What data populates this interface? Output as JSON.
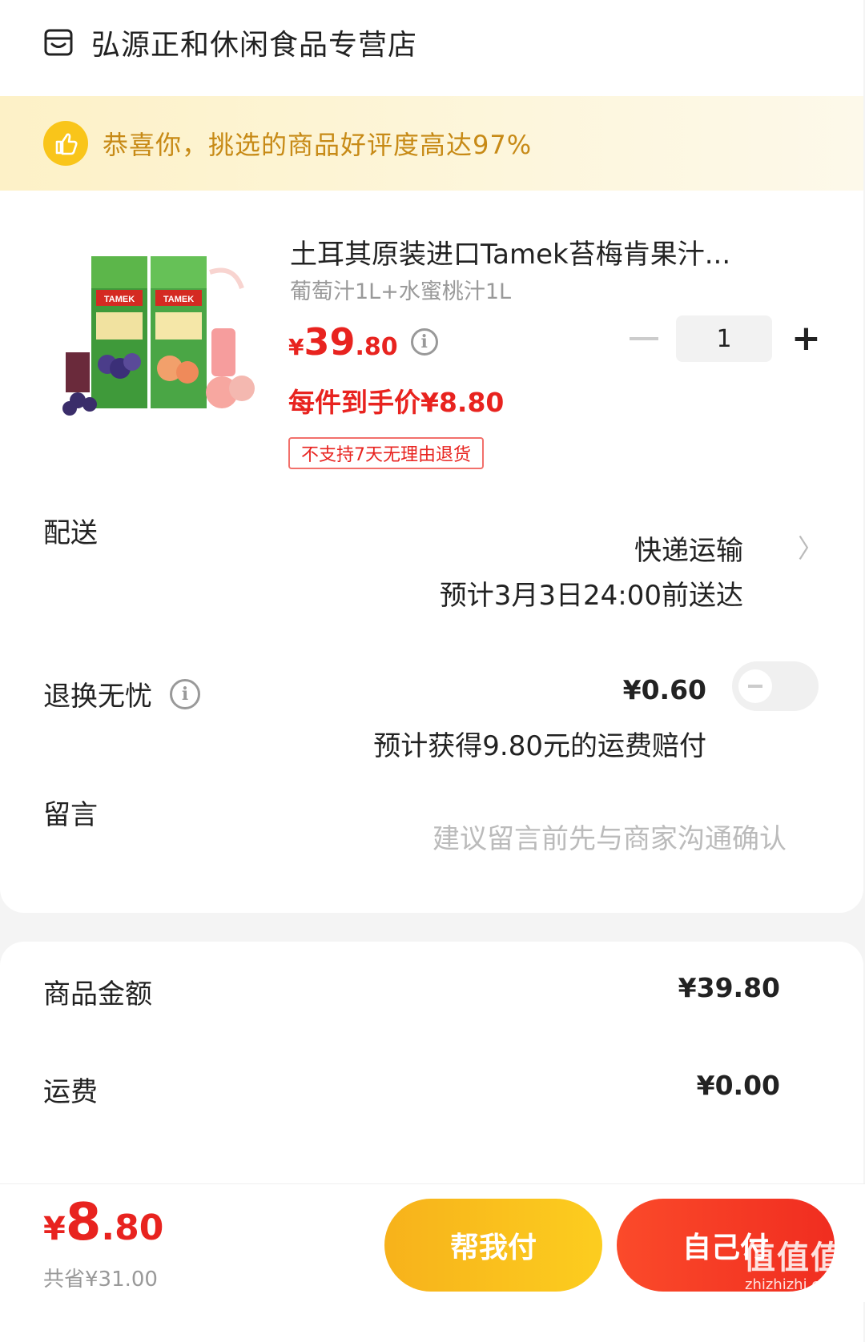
{
  "store": {
    "name": "弘源正和休闲食品专营店",
    "icon": "store-icon"
  },
  "banner": {
    "text": "恭喜你，挑选的商品好评度高达97%",
    "icon": "thumbs-up-icon",
    "accent": "#f9c51a"
  },
  "product": {
    "title": "土耳其原装进口Tamek苔梅肯果汁...",
    "spec": "葡萄汁1L+水蜜桃汁1L",
    "price_currency": "¥",
    "price_int": "39",
    "price_dec": ".80",
    "unit_price": "每件到手价¥8.80",
    "tag": "不支持7天无理由退货",
    "quantity": "1",
    "minus": "—",
    "plus": "+"
  },
  "shipping": {
    "label": "配送",
    "method": "快递运输",
    "eta": "预计3月3日24:00前送达"
  },
  "return_insurance": {
    "label": "退换无忧",
    "price": "¥0.60",
    "compensation": "预计获得9.80元的运费赔付",
    "enabled": false
  },
  "message": {
    "label": "留言",
    "placeholder": "建议留言前先与商家沟通确认"
  },
  "summary": {
    "goods_label": "商品金额",
    "goods_value": "¥39.80",
    "freight_label": "运费",
    "freight_value": "¥0.00"
  },
  "footer": {
    "total_currency": "¥",
    "total_int": "8",
    "total_dec": ".80",
    "saved": "共省¥31.00",
    "help_pay": "帮我付",
    "self_pay": "自己付",
    "watermark": "值值值",
    "watermark_sub": "zhizhizhi.com"
  },
  "colors": {
    "price_red": "#e8231f",
    "brand_yellow": "#f9c51a"
  }
}
